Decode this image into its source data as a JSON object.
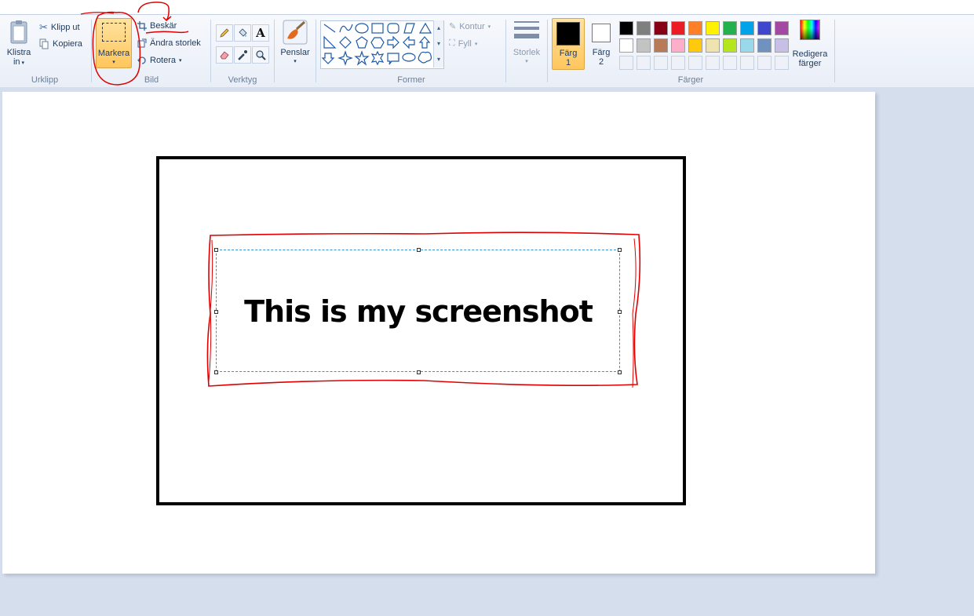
{
  "ribbon": {
    "clipboard": {
      "paste_label_1": "Klistra",
      "paste_label_2": "in",
      "cut_label": "Klipp ut",
      "copy_label": "Kopiera",
      "group_label": "Urklipp"
    },
    "image": {
      "select_label": "Markera",
      "crop_label": "Beskär",
      "resize_label": "Ändra storlek",
      "rotate_label": "Rotera",
      "group_label": "Bild"
    },
    "tools": {
      "group_label": "Verktyg"
    },
    "brushes": {
      "label": "Penslar"
    },
    "shapes": {
      "outline_label": "Kontur",
      "fill_label": "Fyll",
      "group_label": "Former"
    },
    "size": {
      "label": "Storlek"
    },
    "colors": {
      "color1_label_1": "Färg",
      "color1_label_2": "1",
      "color2_label_1": "Färg",
      "color2_label_2": "2",
      "edit_label_1": "Redigera",
      "edit_label_2": "färger",
      "group_label": "Färger",
      "palette_row1": [
        "#000000",
        "#7f7f7f",
        "#880015",
        "#ed1c24",
        "#ff7f27",
        "#fff200",
        "#22b14c",
        "#00a2e8",
        "#3f48cc",
        "#a349a4"
      ],
      "palette_row2": [
        "#ffffff",
        "#c3c3c3",
        "#b97a57",
        "#ffaec9",
        "#ffc90e",
        "#efe4b0",
        "#b5e61d",
        "#99d9ea",
        "#7092be",
        "#c8bfe7"
      ],
      "color1": "#000000",
      "color2": "#ffffff"
    }
  },
  "canvas": {
    "text": "This is my screenshot",
    "annotation_color": "#e00000"
  }
}
